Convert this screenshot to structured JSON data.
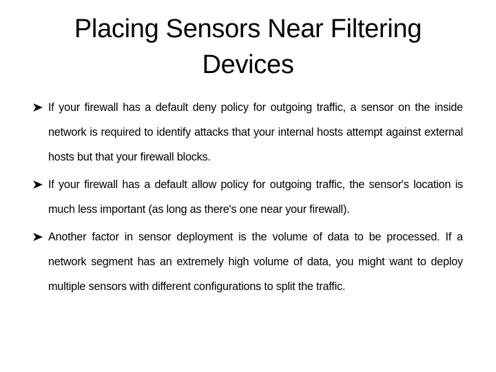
{
  "slide": {
    "title": "Placing Sensors Near Filtering Devices",
    "bullet_icon": "arrowhead-bullet-icon",
    "bullets": [
      {
        "text": "If your firewall has a default deny policy for outgoing traffic, a sensor on the inside network is required to identify attacks that your internal hosts attempt against external hosts but that your firewall blocks."
      },
      {
        "text": "If your firewall has a default allow policy for outgoing traffic, the sensor's location is much less important (as long as there's one near your firewall)."
      },
      {
        "text": "Another factor in sensor deployment is the volume of data to be processed. If a network segment has an extremely high volume of data, you might want to deploy multiple sensors with different configurations to split the traffic."
      }
    ]
  }
}
